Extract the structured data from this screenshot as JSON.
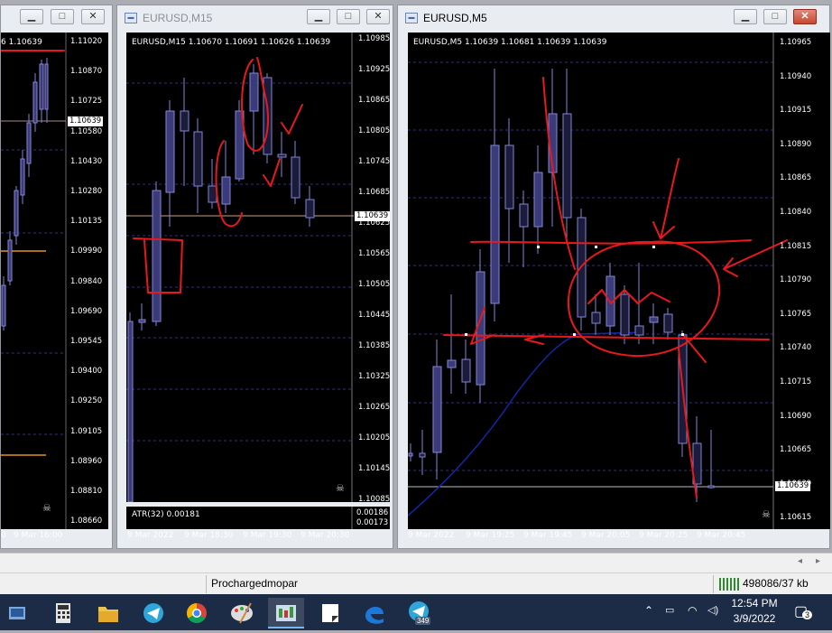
{
  "windows": {
    "left": {
      "info": "6 1.10639",
      "prices": [
        "1.11020",
        "1.10870",
        "1.10725",
        "1.10580",
        "1.10430",
        "1.10280",
        "1.10135",
        "1.09990",
        "1.09840",
        "1.09690",
        "1.09545",
        "1.09400",
        "1.09250",
        "1.09105",
        "1.08960",
        "1.08810",
        "1.08660"
      ],
      "current_price": "1.10639",
      "times": [
        "0",
        "9 Mar 16:00"
      ]
    },
    "m15": {
      "title": "EURUSD,M15",
      "info": "EURUSD,M15  1.10670 1.10691 1.10626 1.10639",
      "prices": [
        "1.10985",
        "1.10925",
        "1.10865",
        "1.10805",
        "1.10745",
        "1.10685",
        "1.10625",
        "1.10565",
        "1.10505",
        "1.10445",
        "1.10385",
        "1.10325",
        "1.10265",
        "1.10205",
        "1.10145",
        "1.10085"
      ],
      "current_price": "1.10639",
      "indicator_label": "ATR(32) 0.00181",
      "indicator_prices": [
        "0.00186",
        "0.00173"
      ],
      "times": [
        "9 Mar 2022",
        "9 Mar 18:30",
        "9 Mar 19:30",
        "9 Mar 20:30"
      ]
    },
    "m5": {
      "title": "EURUSD,M5",
      "info": "EURUSD,M5  1.10639 1.10681 1.10639 1.10639",
      "prices": [
        "1.10965",
        "1.10940",
        "1.10915",
        "1.10890",
        "1.10865",
        "1.10840",
        "1.10815",
        "1.10790",
        "1.10765",
        "1.10740",
        "1.10715",
        "1.10690",
        "1.10665",
        "1.10639",
        "1.10615"
      ],
      "current_price": "1.10639",
      "times": [
        "9 Mar 2022",
        "9 Mar 19:25",
        "9 Mar 19:45",
        "9 Mar 20:05",
        "9 Mar 20:25",
        "9 Mar 20:45"
      ]
    }
  },
  "window_buttons": {
    "minimize": "▁",
    "maximize": "□",
    "close": "✕"
  },
  "statusbar": {
    "profile": "Prochargedmopar",
    "traffic": "498086/37 kb"
  },
  "taskbar": {
    "apps": [
      "start-icon",
      "calculator-icon",
      "file-explorer-icon",
      "telegram-icon",
      "chrome-icon",
      "paint-icon",
      "metatrader-icon",
      "notes-icon",
      "edge-icon",
      "telegram-icon"
    ],
    "badge": "349",
    "time": "12:54 PM",
    "date": "3/9/2022",
    "notifications": "3"
  },
  "colors": {
    "bull": "#3b3b7a",
    "bear": "#1b1b3a",
    "candle_border": "#8585d8",
    "annotation": "#e8191c",
    "ma_line": "#1426a8"
  }
}
